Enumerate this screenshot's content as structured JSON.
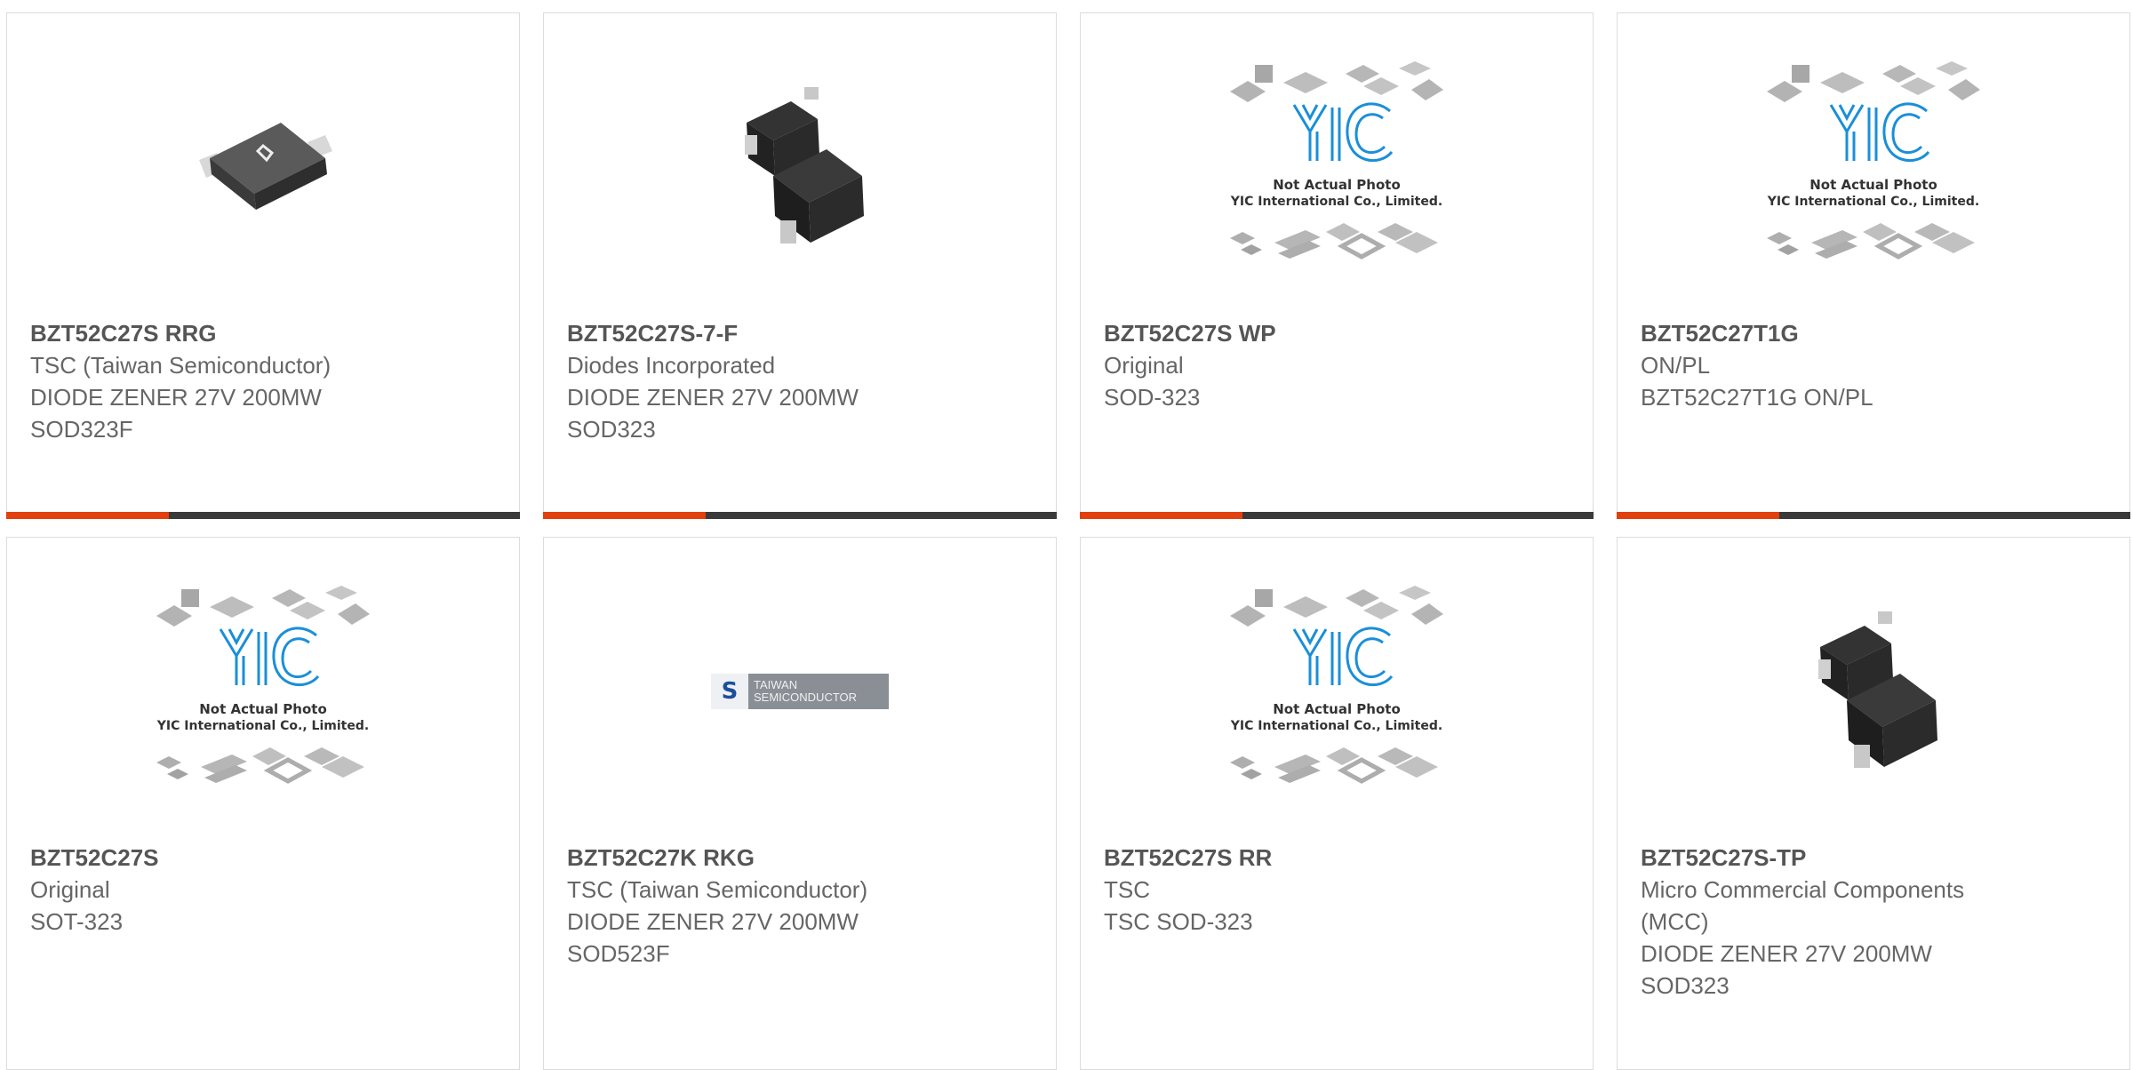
{
  "colors": {
    "accent": "#e2400e",
    "bar": "#3a3a3a",
    "text": "#666666",
    "border": "#dcdcdc",
    "yic_blue": "#1a8fd8"
  },
  "placeholder": {
    "line1": "Not Actual Photo",
    "line2": "YIC International Co., Limited."
  },
  "products": [
    {
      "part": "BZT52C27S RRG",
      "lines": [
        "TSC (Taiwan Semiconductor)",
        "DIODE ZENER 27V 200MW",
        "SOD323F"
      ],
      "image": "sod323f-chip-photo"
    },
    {
      "part": "BZT52C27S-7-F",
      "lines": [
        "Diodes Incorporated",
        "DIODE ZENER 27V 200MW",
        "SOD323"
      ],
      "image": "sod323-chip-photo"
    },
    {
      "part": "BZT52C27S WP",
      "lines": [
        "Original",
        "SOD-323"
      ],
      "image": "yic-placeholder"
    },
    {
      "part": "BZT52C27T1G",
      "lines": [
        "ON/PL",
        "BZT52C27T1G ON/PL"
      ],
      "image": "yic-placeholder"
    },
    {
      "part": "BZT52C27S",
      "lines": [
        "Original",
        "SOT-323"
      ],
      "image": "yic-placeholder"
    },
    {
      "part": "BZT52C27K RKG",
      "lines": [
        "TSC (Taiwan Semiconductor)",
        "DIODE ZENER 27V 200MW",
        "SOD523F"
      ],
      "image": "taiwan-semiconductor-logo"
    },
    {
      "part": "BZT52C27S RR",
      "lines": [
        "TSC",
        "TSC SOD-323"
      ],
      "image": "yic-placeholder"
    },
    {
      "part": "BZT52C27S-TP",
      "lines": [
        "Micro Commercial Components",
        "(MCC)",
        "DIODE ZENER 27V 200MW",
        "SOD323"
      ],
      "image": "sod323-chip-photo"
    }
  ],
  "logo": {
    "line1": "TAIWAN",
    "line2": "SEMICONDUCTOR"
  }
}
